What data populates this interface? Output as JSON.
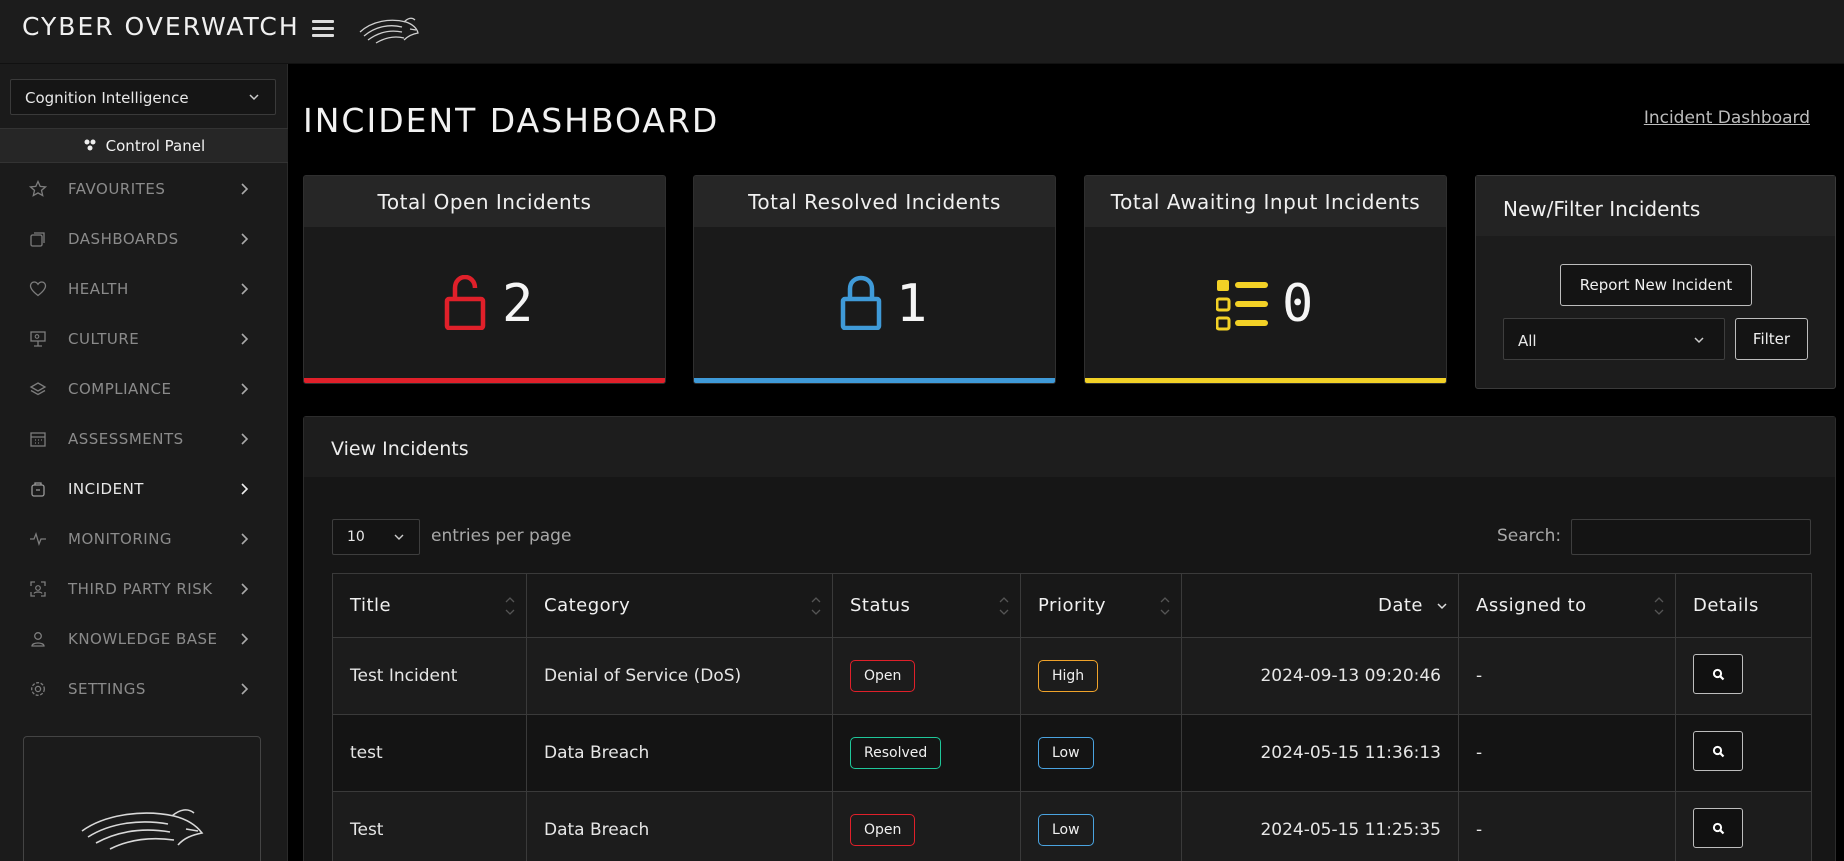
{
  "app": {
    "brand": "CYBER OVERWATCH"
  },
  "sidebar": {
    "org_select": "Cognition Intelligence",
    "control_panel": "Control Panel",
    "items": [
      {
        "label": "FAVOURITES",
        "icon": "star-icon"
      },
      {
        "label": "DASHBOARDS",
        "icon": "dashboards-icon"
      },
      {
        "label": "HEALTH",
        "icon": "heart-icon"
      },
      {
        "label": "CULTURE",
        "icon": "presentation-icon"
      },
      {
        "label": "COMPLIANCE",
        "icon": "layers-icon"
      },
      {
        "label": "ASSESSMENTS",
        "icon": "calendar-icon"
      },
      {
        "label": "INCIDENT",
        "icon": "incident-icon"
      },
      {
        "label": "MONITORING",
        "icon": "pulse-icon"
      },
      {
        "label": "THIRD PARTY RISK",
        "icon": "scan-icon"
      },
      {
        "label": "KNOWLEDGE BASE",
        "icon": "user-icon"
      },
      {
        "label": "SETTINGS",
        "icon": "gear-icon"
      }
    ]
  },
  "header": {
    "title": "INCIDENT DASHBOARD",
    "breadcrumb": "Incident Dashboard"
  },
  "stats": [
    {
      "title": "Total Open Incidents",
      "value": "2",
      "color": "#e0202a",
      "icon": "unlock-icon"
    },
    {
      "title": "Total Resolved Incidents",
      "value": "1",
      "color": "#3f9ad8",
      "icon": "lock-icon"
    },
    {
      "title": "Total Awaiting Input Incidents",
      "value": "0",
      "color": "#f2d126",
      "icon": "list-icon"
    }
  ],
  "filter_card": {
    "title": "New/Filter Incidents",
    "report_button": "Report New Incident",
    "filter_select": "All",
    "filter_button": "Filter"
  },
  "incidents": {
    "title": "View Incidents",
    "entries_value": "10",
    "entries_label": "entries per page",
    "search_label": "Search:",
    "search_value": "",
    "columns": [
      "Title",
      "Category",
      "Status",
      "Priority",
      "Date",
      "Assigned to",
      "Details"
    ],
    "rows": [
      {
        "title": "Test Incident",
        "category": "Denial of Service (DoS)",
        "status": "Open",
        "status_color": "#e0202a",
        "priority": "High",
        "priority_color": "#f0a32a",
        "date": "2024-09-13 09:20:46",
        "assigned": "-"
      },
      {
        "title": "test",
        "category": "Data Breach",
        "status": "Resolved",
        "status_color": "#1fc79a",
        "priority": "Low",
        "priority_color": "#4aa3e0",
        "date": "2024-05-15 11:36:13",
        "assigned": "-"
      },
      {
        "title": "Test",
        "category": "Data Breach",
        "status": "Open",
        "status_color": "#e0202a",
        "priority": "Low",
        "priority_color": "#4aa3e0",
        "date": "2024-05-15 11:25:35",
        "assigned": "-"
      }
    ]
  }
}
